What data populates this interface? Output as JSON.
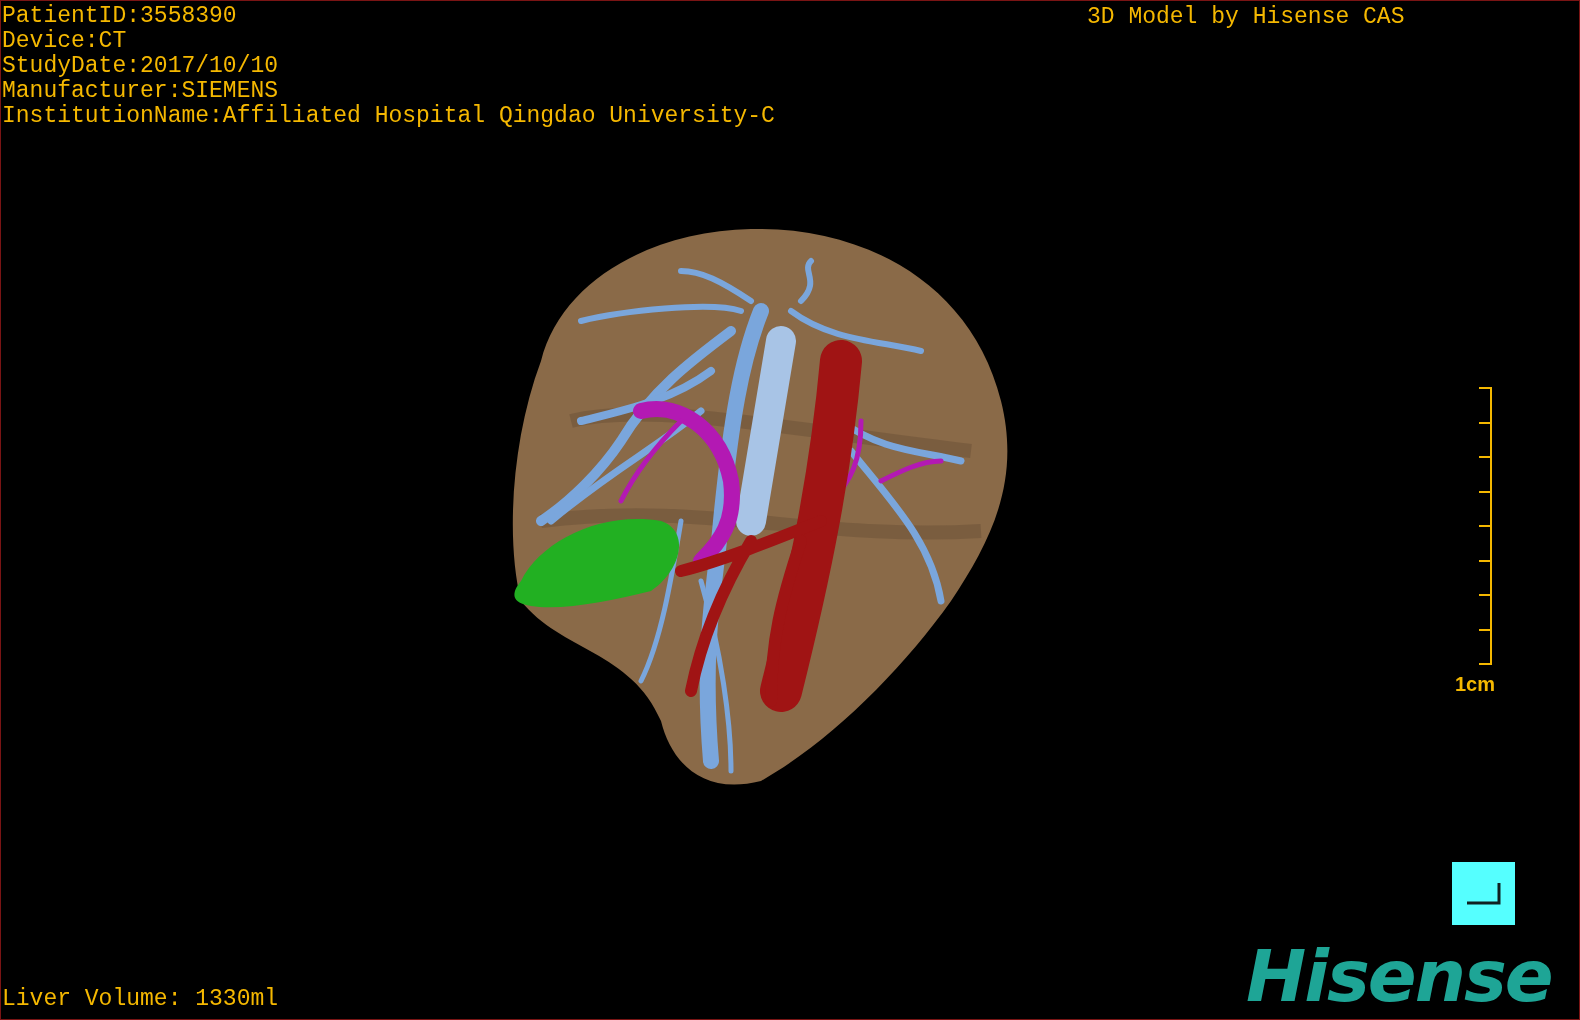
{
  "patient_info": [
    "PatientID:3558390",
    "Device:CT",
    "StudyDate:2017/10/10",
    "Manufacturer:SIEMENS",
    "InstitutionName:Affiliated Hospital Qingdao University-C"
  ],
  "model_title": "3D Model by Hisense CAS",
  "scale_bar": {
    "label": "1cm"
  },
  "logo": "Hisense",
  "liver_volume": "Liver Volume: 1330ml"
}
